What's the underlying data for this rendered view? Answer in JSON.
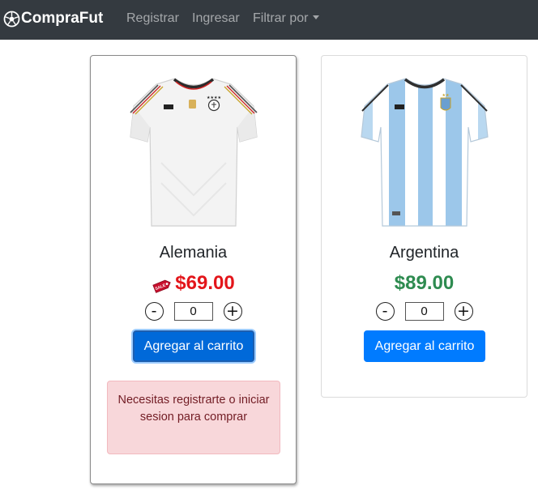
{
  "navbar": {
    "brand": "CompraFut",
    "links": [
      "Registrar",
      "Ingresar"
    ],
    "dropdown": "Filtrar por"
  },
  "products": [
    {
      "name": "Alemania",
      "price": "$69.00",
      "on_sale": true,
      "sale_tag": "SALE",
      "quantity": "0",
      "decrement": "-",
      "increment": "+",
      "button": "Agregar al carrito",
      "alert": "Necesitas registrarte o iniciar sesion para comprar"
    },
    {
      "name": "Argentina",
      "price": "$89.00",
      "on_sale": false,
      "quantity": "0",
      "decrement": "-",
      "increment": "+",
      "button": "Agregar al carrito"
    }
  ],
  "colors": {
    "navbar": "#343a40",
    "sale_price": "#e3151a",
    "regular_price": "#2e8b50",
    "primary_button": "#007bff",
    "alert_bg": "#f8d7da",
    "alert_text": "#721c24"
  },
  "icons": {
    "brand": "soccer-ball-icon",
    "sale": "sale-tag-icon"
  }
}
